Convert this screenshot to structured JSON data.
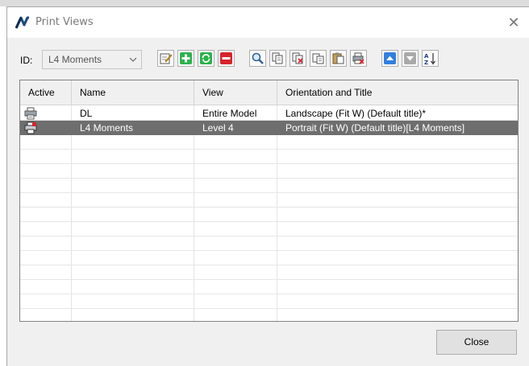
{
  "window": {
    "title": "Print Views",
    "close_glyph": "✕",
    "icon": "app-logo-icon"
  },
  "toolbar": {
    "id_label": "ID:",
    "id_value": "L4 Moments",
    "buttons": [
      {
        "name": "edit-view",
        "icon": "edit-icon"
      },
      {
        "name": "add-view",
        "icon": "plus-icon"
      },
      {
        "name": "refresh-view",
        "icon": "refresh-icon"
      },
      {
        "name": "delete-view",
        "icon": "minus-icon"
      },
      {
        "name": "preview",
        "icon": "magnifier-icon"
      },
      {
        "name": "copy",
        "icon": "copy-icon"
      },
      {
        "name": "copy-delete",
        "icon": "copy-delete-icon"
      },
      {
        "name": "paste-list",
        "icon": "paste-list-icon"
      },
      {
        "name": "paste",
        "icon": "paste-icon"
      },
      {
        "name": "print-delete",
        "icon": "print-delete-icon"
      },
      {
        "name": "move-up",
        "icon": "arrow-up-icon"
      },
      {
        "name": "move-down",
        "icon": "arrow-down-icon"
      },
      {
        "name": "sort",
        "icon": "sort-az-icon"
      }
    ]
  },
  "grid": {
    "columns": [
      "Active",
      "Name",
      "View",
      "Orientation and Title"
    ],
    "rows": [
      {
        "active_icon": "printer-icon",
        "name": "DL",
        "view": "Entire Model",
        "orientation": "Landscape (Fit W) (Default title)*",
        "selected": false
      },
      {
        "active_icon": "printer-active-icon",
        "name": "L4 Moments",
        "view": "Level 4",
        "orientation": "Portrait (Fit W) (Default title)[L4 Moments]",
        "selected": true
      }
    ]
  },
  "footer": {
    "close_label": "Close"
  }
}
